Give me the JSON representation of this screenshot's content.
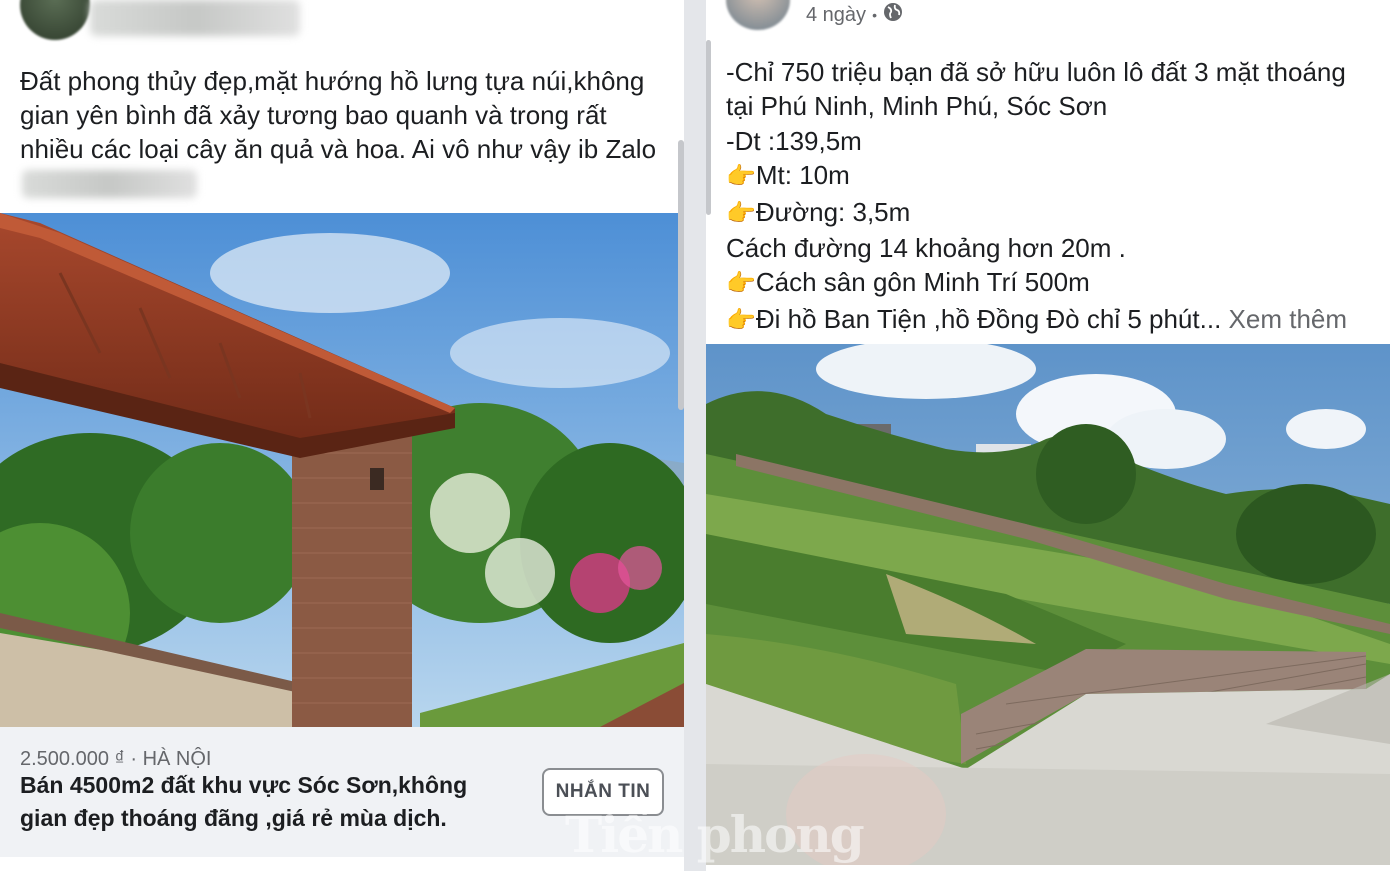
{
  "left_post": {
    "text": "Đất phong thủy đẹp,mặt hướng hồ lưng tựa núi,không\ngian yên bình đã xảy tương bao quanh và trong rất\nnhiều các loại cây ăn quả và hoa. Ai vô như vậy ib Zalo",
    "marketplace": {
      "price_location": "2.500.000 ₫ · HÀ NỘI",
      "title": "Bán 4500m2 đất khu vực Sóc Sơn,không\ngian đẹp thoáng đãng ,giá rẻ mùa dịch.",
      "message_button": "NHẮN TIN"
    }
  },
  "right_post": {
    "timestamp": "4 ngày",
    "separator": "•",
    "audience_icon": "globe-icon",
    "lines": [
      "-Chỉ 750 triệu bạn đã sở hữu luôn lô đất 3 mặt thoáng",
      "tại Phú Ninh, Minh Phú, Sóc Sơn",
      "-Dt :139,5m"
    ],
    "bullets": [
      "Mt: 10m",
      "Đường: 3,5m"
    ],
    "line_after": "Cách đường 14 khoảng hơn 20m .",
    "bullets2": [
      "Cách sân gôn Minh Trí 500m"
    ],
    "last_bullet": "Đi hồ Ban Tiện ,hồ Đồng Đò chỉ 5 phút...",
    "see_more": "Xem thêm",
    "bullet_icon": "pointing-hand-icon"
  },
  "watermark": "Tiền phong",
  "colors": {
    "text": "#1c1e21",
    "muted": "#65676b"
  }
}
